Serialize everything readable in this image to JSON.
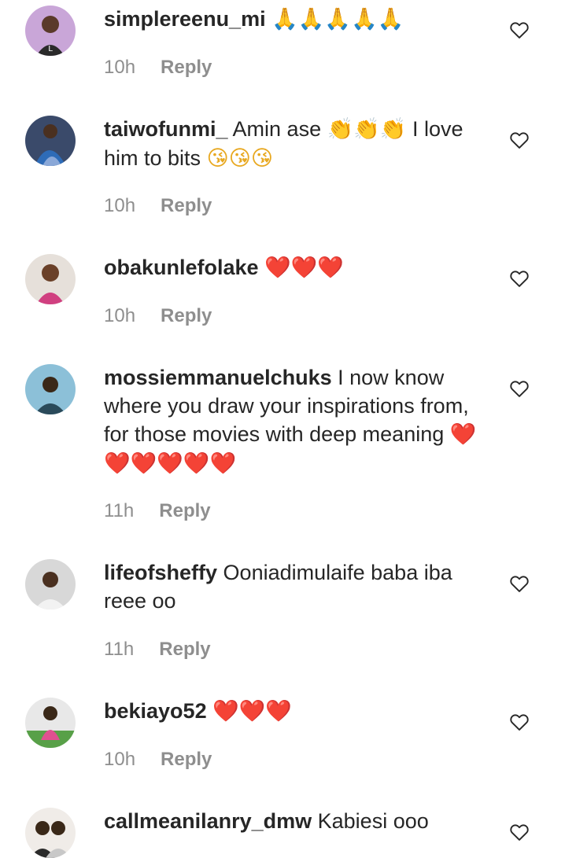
{
  "reply_label": "Reply",
  "heart_color": "#262626",
  "comments": [
    {
      "username": "simplereenu_mi",
      "text": "",
      "emojis": "🙏🙏🙏🙏🙏",
      "emoji_color": "#e8a820",
      "time": "10h"
    },
    {
      "username": "taiwofunmi_",
      "text": "Amin ase",
      "emojis": "👏👏👏",
      "emoji_color": "#e8a820",
      "text2": "I love him to bits",
      "emojis2": "😘😘😘",
      "time": "10h"
    },
    {
      "username": "obakunlefolake",
      "text": "",
      "emojis": "❤️❤️❤️",
      "emoji_color": "#d4142a",
      "time": "10h"
    },
    {
      "username": "mossiemmanuelchuks",
      "text": "I now know where you draw your inspirations from, for those movies with deep meaning",
      "emojis": "❤️❤️❤️❤️❤️❤️",
      "emoji_color": "#d4142a",
      "time": "11h"
    },
    {
      "username": "lifeofsheffy",
      "text": "Ooniadimulaife baba iba reee oo",
      "emojis": "",
      "time": "11h"
    },
    {
      "username": "bekiayo52",
      "text": "",
      "emojis": "❤️❤️❤️",
      "emoji_color": "#d4142a",
      "time": "10h"
    },
    {
      "username": "callmeanilanry_dmw",
      "text": "Kabiesi ooo",
      "emojis": "",
      "time": ""
    }
  ]
}
